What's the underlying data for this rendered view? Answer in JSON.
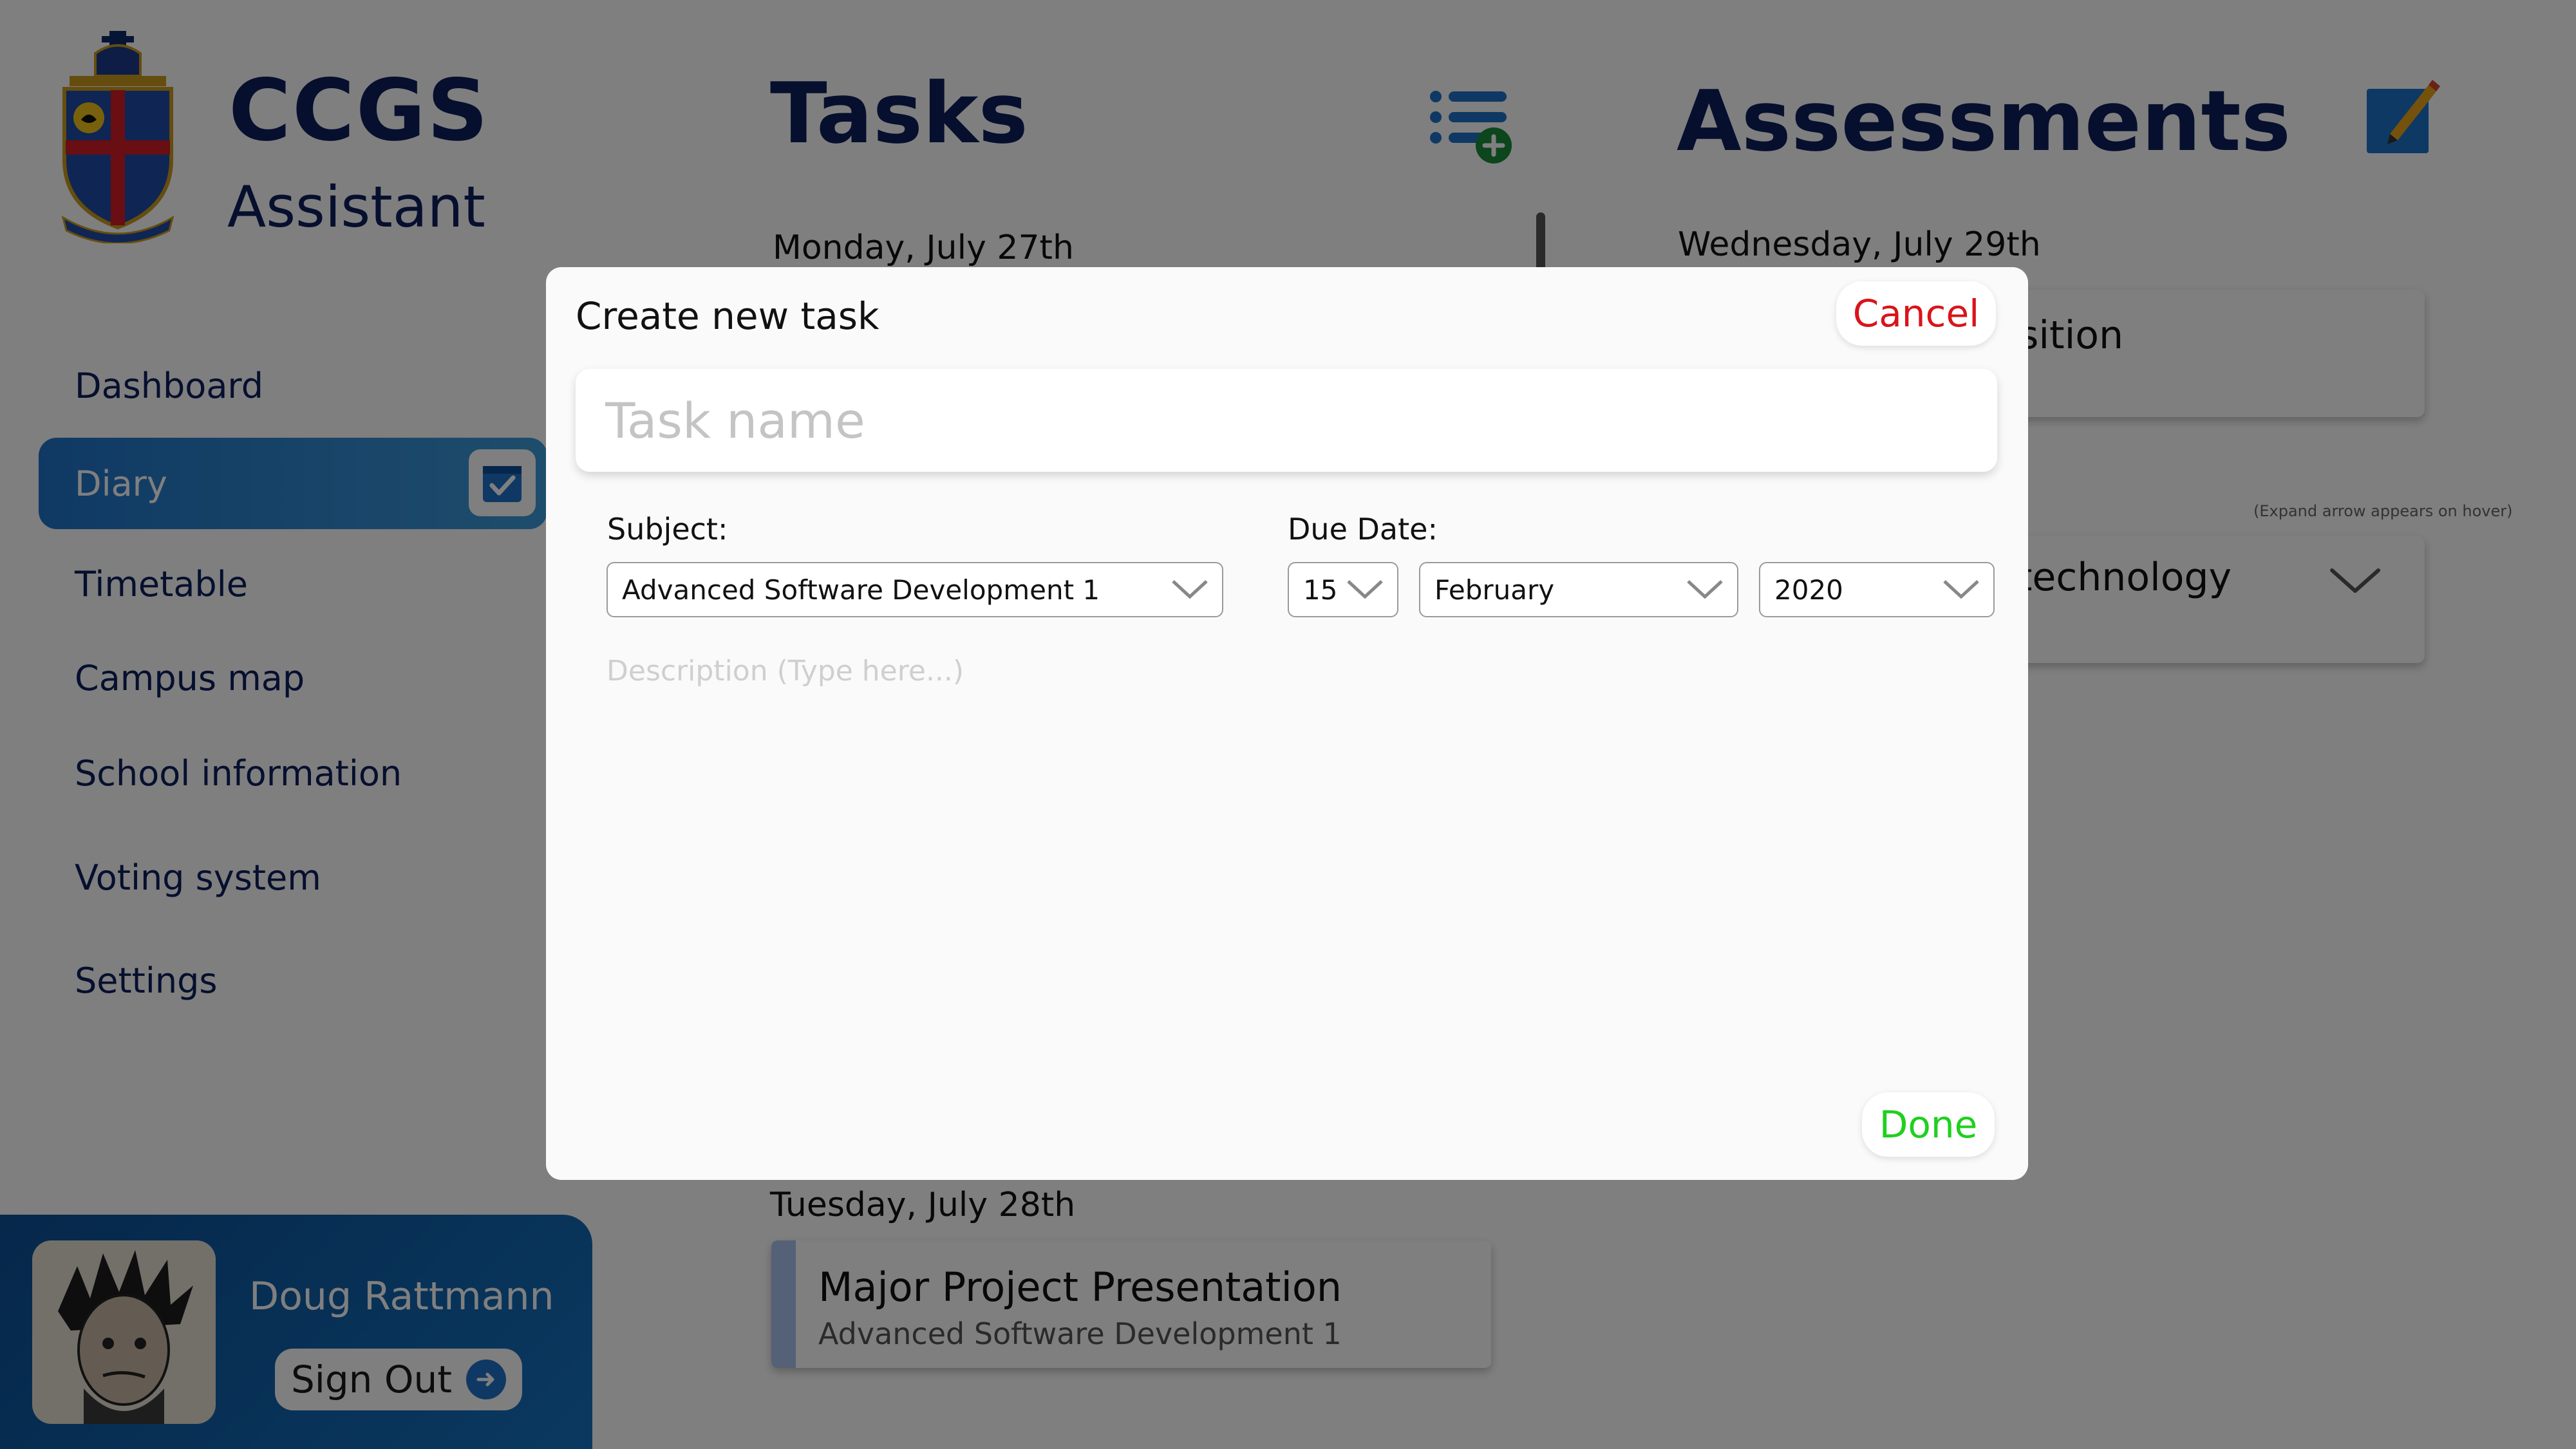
{
  "brand": {
    "title": "CCGS",
    "subtitle": "Assistant"
  },
  "sidebar": {
    "items": [
      {
        "label": "Dashboard"
      },
      {
        "label": "Diary",
        "active": true
      },
      {
        "label": "Timetable"
      },
      {
        "label": "Campus map"
      },
      {
        "label": "School information"
      },
      {
        "label": "Voting system"
      },
      {
        "label": "Settings"
      }
    ]
  },
  "user": {
    "name": "Doug Rattmann",
    "sign_out_label": "Sign Out"
  },
  "tasks": {
    "title": "Tasks",
    "groups": [
      {
        "date": "Monday, July 27th"
      },
      {
        "date": "Tuesday, July 28th",
        "items": [
          {
            "title": "Major Project Presentation",
            "subject": "Advanced Software Development 1"
          }
        ]
      }
    ]
  },
  "assessments": {
    "title": "Assessments",
    "date": "Wednesday, July 29th",
    "cards": [
      {
        "visible_text": "osition"
      },
      {
        "visible_text": "otechnology"
      }
    ],
    "hover_hint": "(Expand arrow appears on hover)"
  },
  "modal": {
    "title": "Create new task",
    "cancel_label": "Cancel",
    "task_name_placeholder": "Task name",
    "subject_label": "Subject:",
    "subject_value": "Advanced Software Development 1",
    "due_date_label": "Due Date:",
    "day_value": "15",
    "month_value": "February",
    "year_value": "2020",
    "description_placeholder": "Description (Type here...)",
    "done_label": "Done"
  },
  "colors": {
    "primary_navy": "#0c1f5c",
    "accent_blue": "#1f73c8",
    "cancel_red": "#d9141a",
    "done_green": "#1fd01f"
  }
}
